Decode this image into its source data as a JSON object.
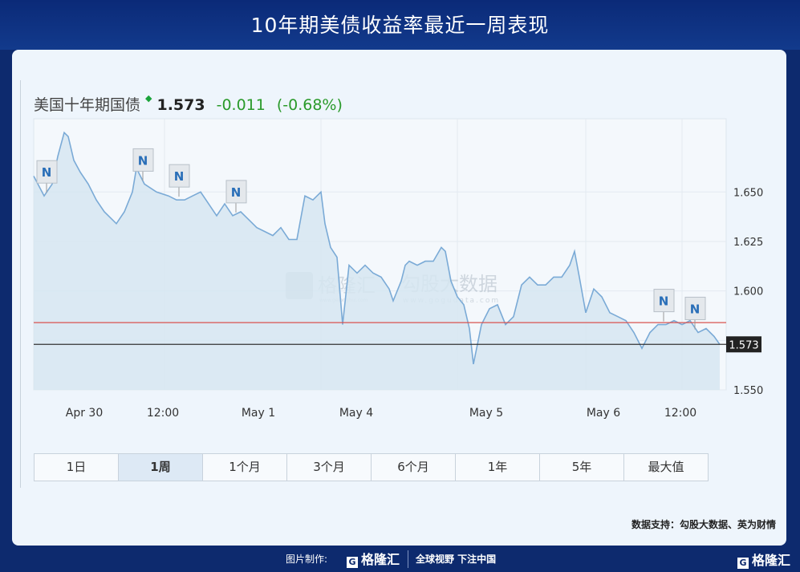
{
  "title": "10年期美债收益率最近一周表现",
  "quote": {
    "name": "美国十年期国债",
    "direction_icon": "down-arrow",
    "last": "1.573",
    "change": "-0.011",
    "change_pct": "(-0.68%)"
  },
  "watermark": {
    "text": "勾股大数据",
    "url": "www.gogudata.com",
    "brand": "格隆汇"
  },
  "timeframes": [
    {
      "label": "1日"
    },
    {
      "label": "1周",
      "active": true
    },
    {
      "label": "1个月"
    },
    {
      "label": "3个月"
    },
    {
      "label": "6个月"
    },
    {
      "label": "1年"
    },
    {
      "label": "5年"
    },
    {
      "label": "最大值"
    }
  ],
  "source": "数据支持：勾股大数据、英为财情",
  "footer": {
    "made_by": "图片制作:",
    "logo": "格隆汇",
    "slogan": "全球视野 下注中国",
    "logo_right": "格隆汇"
  },
  "colors": {
    "line": "#7aaad6",
    "fill": "#d6e6f1",
    "prev_close": "#d9534f",
    "current": "#333333",
    "positive": "#2a9a2a"
  },
  "chart_data": {
    "type": "area",
    "title": "美国十年期国债",
    "xlabel": "",
    "ylabel": "",
    "ylim": [
      1.55,
      1.687
    ],
    "xlim": [
      0,
      863
    ],
    "y_ticks": [
      1.55,
      1.575,
      1.6,
      1.625,
      1.65
    ],
    "y_tick_labels": [
      "1.550",
      "",
      "1.600",
      "1.625",
      "1.650"
    ],
    "x_ticks": [
      {
        "x": 63,
        "label": "Apr 30"
      },
      {
        "x": 161,
        "label": "12:00"
      },
      {
        "x": 280,
        "label": "May 1"
      },
      {
        "x": 402,
        "label": "May 4"
      },
      {
        "x": 564,
        "label": "May 5"
      },
      {
        "x": 710,
        "label": "May 6"
      },
      {
        "x": 806,
        "label": "12:00"
      }
    ],
    "prev_close": 1.584,
    "current": {
      "value": 1.573,
      "label": "1.573"
    },
    "news_markers": [
      {
        "x": 16,
        "label": "N"
      },
      {
        "x": 136,
        "label": "N"
      },
      {
        "x": 181,
        "label": "N"
      },
      {
        "x": 252,
        "label": "N"
      },
      {
        "x": 785,
        "label": "N"
      },
      {
        "x": 824,
        "label": "N"
      }
    ],
    "points": [
      [
        0,
        1.658
      ],
      [
        13,
        1.648
      ],
      [
        23,
        1.654
      ],
      [
        30,
        1.668
      ],
      [
        38,
        1.68
      ],
      [
        43,
        1.678
      ],
      [
        50,
        1.666
      ],
      [
        58,
        1.66
      ],
      [
        68,
        1.654
      ],
      [
        78,
        1.646
      ],
      [
        88,
        1.64
      ],
      [
        98,
        1.636
      ],
      [
        103,
        1.634
      ],
      [
        113,
        1.64
      ],
      [
        123,
        1.65
      ],
      [
        128,
        1.662
      ],
      [
        138,
        1.654
      ],
      [
        153,
        1.65
      ],
      [
        168,
        1.648
      ],
      [
        178,
        1.646
      ],
      [
        188,
        1.646
      ],
      [
        198,
        1.648
      ],
      [
        208,
        1.65
      ],
      [
        218,
        1.644
      ],
      [
        228,
        1.638
      ],
      [
        238,
        1.644
      ],
      [
        248,
        1.638
      ],
      [
        258,
        1.64
      ],
      [
        268,
        1.636
      ],
      [
        278,
        1.632
      ],
      [
        288,
        1.63
      ],
      [
        298,
        1.628
      ],
      [
        308,
        1.632
      ],
      [
        318,
        1.626
      ],
      [
        328,
        1.626
      ],
      [
        338,
        1.648
      ],
      [
        348,
        1.646
      ],
      [
        358,
        1.65
      ],
      [
        363,
        1.634
      ],
      [
        370,
        1.622
      ],
      [
        378,
        1.617
      ],
      [
        385,
        1.583
      ],
      [
        393,
        1.613
      ],
      [
        403,
        1.609
      ],
      [
        413,
        1.613
      ],
      [
        423,
        1.609
      ],
      [
        433,
        1.607
      ],
      [
        443,
        1.601
      ],
      [
        448,
        1.595
      ],
      [
        458,
        1.605
      ],
      [
        463,
        1.613
      ],
      [
        468,
        1.615
      ],
      [
        478,
        1.613
      ],
      [
        488,
        1.615
      ],
      [
        498,
        1.615
      ],
      [
        508,
        1.622
      ],
      [
        513,
        1.62
      ],
      [
        520,
        1.605
      ],
      [
        528,
        1.597
      ],
      [
        536,
        1.593
      ],
      [
        543,
        1.581
      ],
      [
        548,
        1.563
      ],
      [
        558,
        1.583
      ],
      [
        568,
        1.591
      ],
      [
        578,
        1.593
      ],
      [
        588,
        1.583
      ],
      [
        598,
        1.587
      ],
      [
        608,
        1.603
      ],
      [
        618,
        1.607
      ],
      [
        628,
        1.603
      ],
      [
        638,
        1.603
      ],
      [
        648,
        1.607
      ],
      [
        658,
        1.607
      ],
      [
        668,
        1.613
      ],
      [
        674,
        1.62
      ],
      [
        680,
        1.607
      ],
      [
        688,
        1.589
      ],
      [
        698,
        1.601
      ],
      [
        708,
        1.597
      ],
      [
        718,
        1.589
      ],
      [
        728,
        1.587
      ],
      [
        738,
        1.585
      ],
      [
        748,
        1.579
      ],
      [
        758,
        1.571
      ],
      [
        768,
        1.579
      ],
      [
        778,
        1.583
      ],
      [
        788,
        1.583
      ],
      [
        798,
        1.585
      ],
      [
        808,
        1.583
      ],
      [
        818,
        1.585
      ],
      [
        828,
        1.579
      ],
      [
        838,
        1.581
      ],
      [
        848,
        1.577
      ],
      [
        855,
        1.573
      ]
    ]
  }
}
